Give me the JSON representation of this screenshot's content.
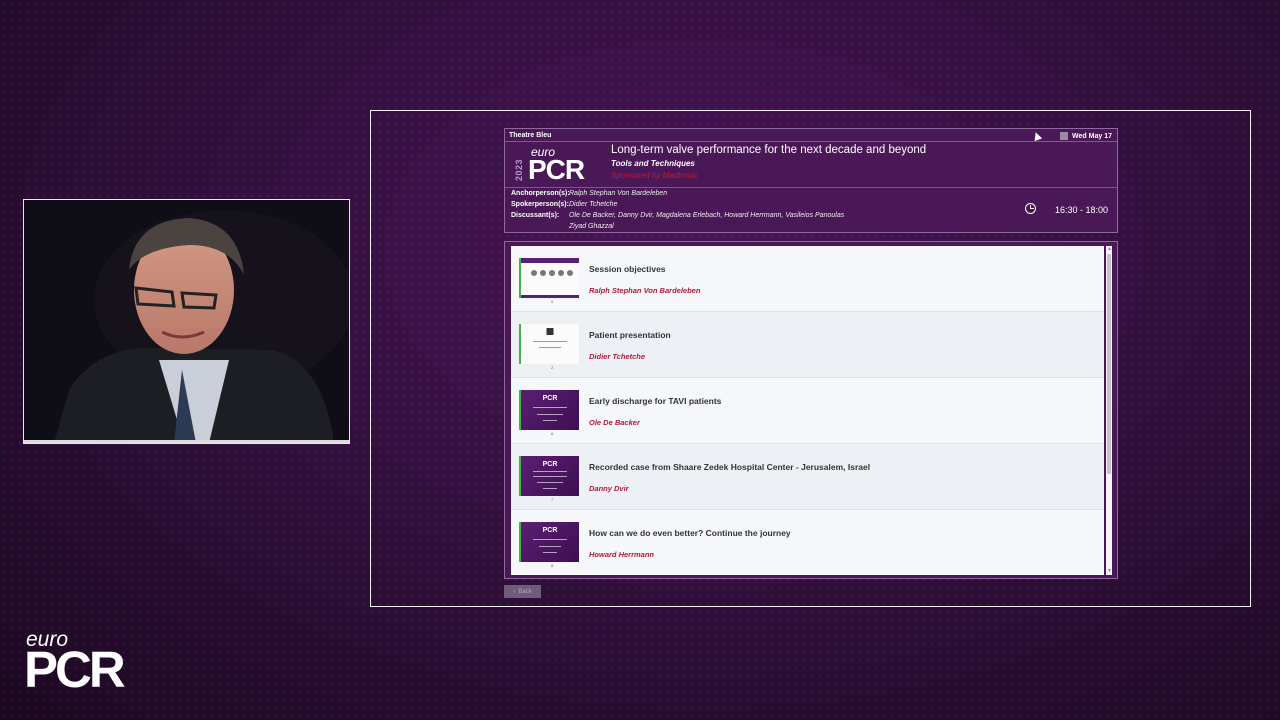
{
  "session": {
    "room": "Theatre Bleu",
    "date": "Wed May 17",
    "year": "2023",
    "logo_euro": "euro",
    "logo_pcr": "PCR",
    "title": "Long-term valve performance for the next decade and beyond",
    "subtitle": "Tools and Techniques",
    "sponsor": "Sponsored by Medtronic",
    "roles": {
      "anchor_label": "Anchorperson(s):",
      "anchor": "Ralph Stephan Von Bardeleben",
      "spoke_label": "Spokerperson(s):",
      "spoke": "Didier Tchetche",
      "disc_label": "Discussant(s):",
      "disc_line1": "Ole De Backer, Danny Dvir, Magdalena Erlebach, Howard Herrmann, Vasileios Panoulas",
      "disc_line2": "Ziyad Ghazzal"
    },
    "time": "16:30 - 18:00"
  },
  "presentations": [
    {
      "title": "Session objectives",
      "speaker": "Ralph Stephan Von Bardeleben",
      "page": "0"
    },
    {
      "title": "Patient presentation",
      "speaker": "Didier Tchetche",
      "page": "2"
    },
    {
      "title": "Early discharge for TAVI patients",
      "speaker": "Ole De Backer",
      "page": "6"
    },
    {
      "title": "Recorded case from Shaare Zedek Hospital Center - Jerusalem, Israel",
      "speaker": "Danny Dvir",
      "page": "7"
    },
    {
      "title": "How can we do even better? Continue the journey",
      "speaker": "Howard Herrmann",
      "page": "8"
    }
  ],
  "nav": {
    "back_label": "Back"
  },
  "brand": {
    "euro": "euro",
    "pcr": "PCR"
  },
  "colors": {
    "accent_red": "#b11a3b",
    "panel_purple": "#4a1857",
    "thumb_green": "#41b34a"
  }
}
